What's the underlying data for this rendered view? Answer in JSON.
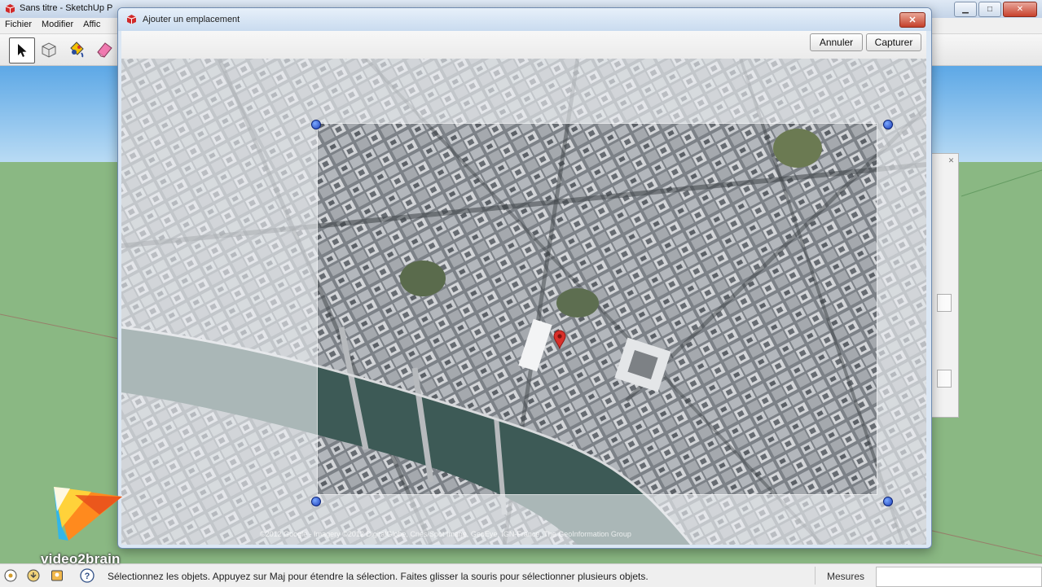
{
  "app": {
    "title": "Sans titre - SketchUp P",
    "menu": [
      "Fichier",
      "Modifier",
      "Affic"
    ],
    "tools": [
      "select-arrow-icon",
      "component-icon",
      "paint-bucket-icon",
      "eraser-icon"
    ]
  },
  "dialog": {
    "title": "Ajouter un emplacement",
    "buttons": {
      "cancel": "Annuler",
      "capture": "Capturer"
    },
    "copyright": "©2012 Google - Imagery ©2012 DigitalGlobe, Cnes/Spot Image, GeoEye, IGN-France, The GeoInformation Group"
  },
  "statusbar": {
    "text": "Sélectionnez les objets. Appuyez sur Maj pour étendre la sélection. Faites glisser la souris pour sélectionner plusieurs objets.",
    "measures_label": "Mesures",
    "measures_value": ""
  },
  "watermark": {
    "brand": "video2brain"
  },
  "colors": {
    "sky": "#5da8e6",
    "ground": "#8ab883",
    "river": "#3d5a56",
    "handle": "#1d3fb8",
    "pin": "#d9302a"
  }
}
